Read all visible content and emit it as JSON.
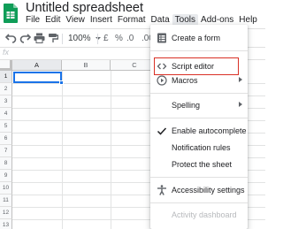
{
  "document": {
    "title": "Untitled spreadsheet"
  },
  "menubar": {
    "items": [
      "File",
      "Edit",
      "View",
      "Insert",
      "Format",
      "Data",
      "Tools",
      "Add-ons",
      "Help"
    ],
    "active": "Tools"
  },
  "toolbar": {
    "zoom": "100%",
    "currency": "£",
    "percent": "%",
    "decrease_decimals": ".0",
    "increase_decimals": ".00"
  },
  "formula_bar": {
    "fx_label": "fx"
  },
  "grid": {
    "columns": [
      "A",
      "B",
      "C"
    ],
    "rows": [
      "1",
      "2",
      "3",
      "4",
      "5",
      "6",
      "7",
      "8",
      "9",
      "10",
      "11",
      "12",
      "13"
    ],
    "selected_cell": "A1"
  },
  "tools_menu": {
    "items": [
      {
        "label": "Create a form",
        "icon": "form-icon",
        "enabled": true
      },
      {
        "label": "Script editor",
        "icon": "code-icon",
        "enabled": true,
        "highlighted": true
      },
      {
        "label": "Macros",
        "icon": "play-circle-icon",
        "enabled": true,
        "submenu": true
      },
      {
        "label": "Spelling",
        "icon": "",
        "enabled": true,
        "submenu": true
      },
      {
        "label": "Enable autocomplete",
        "icon": "check-icon",
        "enabled": true,
        "checked": true
      },
      {
        "label": "Notification rules",
        "icon": "",
        "enabled": true
      },
      {
        "label": "Protect the sheet",
        "icon": "",
        "enabled": true
      },
      {
        "label": "Accessibility settings",
        "icon": "accessibility-icon",
        "enabled": true
      },
      {
        "label": "Activity dashboard",
        "icon": "",
        "enabled": false
      }
    ]
  },
  "colors": {
    "sheets_green": "#0f9d58",
    "selection_blue": "#1a73e8",
    "highlight_red": "#d93025"
  }
}
